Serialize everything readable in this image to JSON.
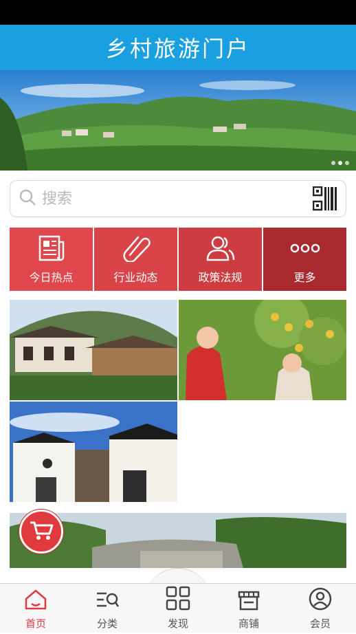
{
  "app": {
    "title": "乡村旅游门户"
  },
  "banner": {
    "slide_count": 3,
    "active_slide": 1
  },
  "search": {
    "placeholder": "搜索",
    "icon": "search-icon",
    "scan_icon": "qr-code-icon"
  },
  "quick_menu": [
    {
      "label": "今日热点",
      "icon": "newspaper-icon",
      "color": "#e0474c"
    },
    {
      "label": "行业动态",
      "icon": "paperclip-icon",
      "color": "#d84448"
    },
    {
      "label": "政策法规",
      "icon": "users-icon",
      "color": "#cc3c41"
    },
    {
      "label": "更多",
      "icon": "more-icon",
      "color": "#a82a2e"
    }
  ],
  "content_tiles": [
    {
      "subject": "village-houses-image"
    },
    {
      "subject": "fruit-picking-image"
    },
    {
      "subject": "white-wall-houses-image"
    },
    {
      "subject": "stone-landscape-image"
    }
  ],
  "floating": {
    "icon": "cart-icon",
    "color": "#e0393e"
  },
  "tabbar": {
    "items": [
      {
        "label": "首页",
        "icon": "home-icon",
        "active": true
      },
      {
        "label": "分类",
        "icon": "category-search-icon",
        "active": false
      },
      {
        "label": "发现",
        "icon": "grid-icon",
        "active": false
      },
      {
        "label": "商铺",
        "icon": "shop-icon",
        "active": false
      },
      {
        "label": "会员",
        "icon": "user-icon",
        "active": false
      }
    ],
    "active_color": "#e0393e"
  },
  "colors": {
    "header": "#1a9fe0",
    "accent": "#e0393e"
  }
}
